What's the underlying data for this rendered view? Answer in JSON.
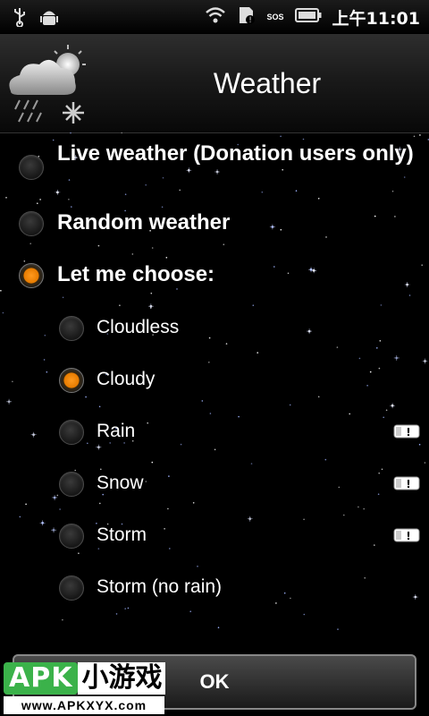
{
  "status_bar": {
    "icons": [
      "usb-icon",
      "android-debug-icon",
      "wifi-icon",
      "sim-icon",
      "sos-icon",
      "battery-icon"
    ],
    "sos_text": "SOS",
    "time": "上午11:01"
  },
  "header": {
    "title": "Weather"
  },
  "options": [
    {
      "label": "Live weather (Donation users only)",
      "checked": false
    },
    {
      "label": "Random weather",
      "checked": false
    },
    {
      "label": "Let me choose:",
      "checked": true
    }
  ],
  "choices": [
    {
      "label": "Cloudless",
      "checked": false,
      "locked": false
    },
    {
      "label": "Cloudy",
      "checked": true,
      "locked": false
    },
    {
      "label": "Rain",
      "checked": false,
      "locked": true
    },
    {
      "label": "Snow",
      "checked": false,
      "locked": true
    },
    {
      "label": "Storm",
      "checked": false,
      "locked": true
    },
    {
      "label": "Storm (no rain)",
      "checked": false,
      "locked": false
    }
  ],
  "ok_label": "OK",
  "watermark": {
    "apk": "APK",
    "cn": "小游戏",
    "url": "www.APKXYX.com"
  },
  "colors": {
    "accent": "#f28a12",
    "background": "#000000"
  }
}
